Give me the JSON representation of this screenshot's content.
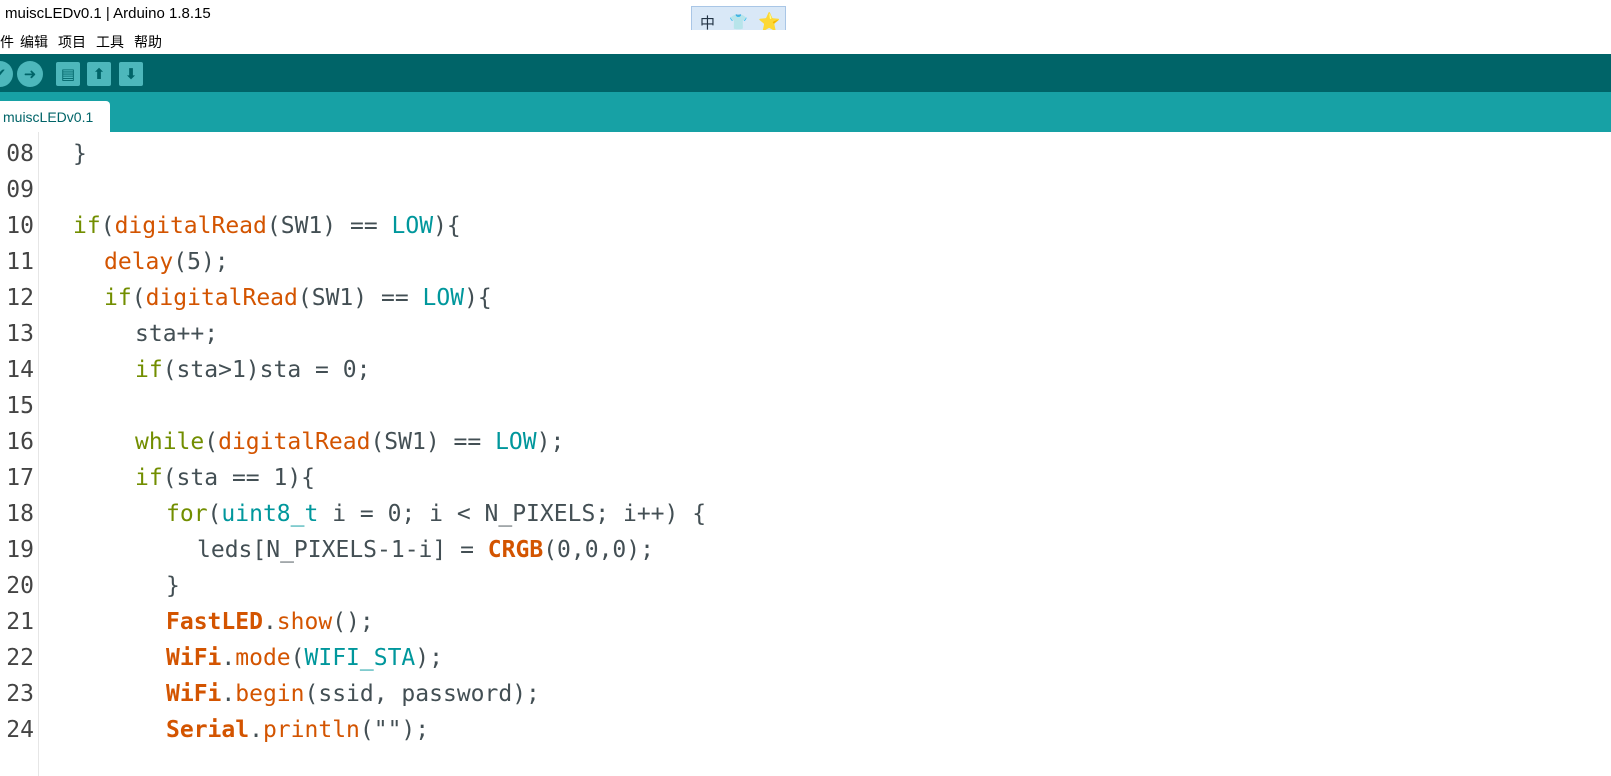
{
  "window": {
    "title": "muiscLEDv0.1 | Arduino 1.8.15"
  },
  "ime": {
    "items": [
      "中",
      "👕",
      "⭐"
    ]
  },
  "menu": {
    "items": [
      "件",
      "编辑",
      "项目",
      "工具",
      "帮助"
    ]
  },
  "toolbar": {
    "verify_icon": "✔",
    "upload_icon": "➜",
    "new_icon": "▤",
    "open_icon": "⬆",
    "save_icon": "⬇"
  },
  "tab": {
    "label": "muiscLEDv0.1"
  },
  "theme": {
    "toolbar_bg": "#006468",
    "tabbar_bg": "#17a1a5",
    "keyword": "#728e00",
    "function": "#d35400",
    "constant": "#00979c"
  },
  "editor": {
    "lines": [
      {
        "num": "08",
        "indent": 1,
        "tokens": [
          {
            "t": "}",
            "c": "t"
          }
        ]
      },
      {
        "num": "09",
        "indent": 0,
        "tokens": []
      },
      {
        "num": "10",
        "indent": 1,
        "tokens": [
          {
            "t": "if",
            "c": "kw"
          },
          {
            "t": "(",
            "c": "t"
          },
          {
            "t": "digitalRead",
            "c": "fn"
          },
          {
            "t": "(SW1) == ",
            "c": "t"
          },
          {
            "t": "LOW",
            "c": "const"
          },
          {
            "t": "){",
            "c": "t"
          }
        ]
      },
      {
        "num": "11",
        "indent": 2,
        "tokens": [
          {
            "t": "delay",
            "c": "fn"
          },
          {
            "t": "(5);",
            "c": "t"
          }
        ]
      },
      {
        "num": "12",
        "indent": 2,
        "tokens": [
          {
            "t": "if",
            "c": "kw"
          },
          {
            "t": "(",
            "c": "t"
          },
          {
            "t": "digitalRead",
            "c": "fn"
          },
          {
            "t": "(SW1) == ",
            "c": "t"
          },
          {
            "t": "LOW",
            "c": "const"
          },
          {
            "t": "){",
            "c": "t"
          }
        ]
      },
      {
        "num": "13",
        "indent": 3,
        "tokens": [
          {
            "t": "sta++;",
            "c": "t"
          }
        ]
      },
      {
        "num": "14",
        "indent": 3,
        "tokens": [
          {
            "t": "if",
            "c": "kw"
          },
          {
            "t": "(sta>1)sta = 0;",
            "c": "t"
          }
        ]
      },
      {
        "num": "15",
        "indent": 0,
        "tokens": []
      },
      {
        "num": "16",
        "indent": 3,
        "tokens": [
          {
            "t": "while",
            "c": "kw"
          },
          {
            "t": "(",
            "c": "t"
          },
          {
            "t": "digitalRead",
            "c": "fn"
          },
          {
            "t": "(SW1) == ",
            "c": "t"
          },
          {
            "t": "LOW",
            "c": "const"
          },
          {
            "t": ");",
            "c": "t"
          }
        ]
      },
      {
        "num": "17",
        "indent": 3,
        "tokens": [
          {
            "t": "if",
            "c": "kw"
          },
          {
            "t": "(sta == 1){",
            "c": "t"
          }
        ]
      },
      {
        "num": "18",
        "indent": 4,
        "tokens": [
          {
            "t": "for",
            "c": "kw"
          },
          {
            "t": "(",
            "c": "t"
          },
          {
            "t": "uint8_t",
            "c": "const"
          },
          {
            "t": " i = 0; i < N_PIXELS; i++) {",
            "c": "t"
          }
        ]
      },
      {
        "num": "19",
        "indent": 5,
        "tokens": [
          {
            "t": "leds[N_PIXELS-1-i] = ",
            "c": "t"
          },
          {
            "t": "CRGB",
            "c": "cls"
          },
          {
            "t": "(0,0,0);",
            "c": "t"
          }
        ]
      },
      {
        "num": "20",
        "indent": 4,
        "tokens": [
          {
            "t": "}",
            "c": "t"
          }
        ]
      },
      {
        "num": "21",
        "indent": 4,
        "tokens": [
          {
            "t": "FastLED",
            "c": "cls"
          },
          {
            "t": ".",
            "c": "t"
          },
          {
            "t": "show",
            "c": "fn"
          },
          {
            "t": "();",
            "c": "t"
          }
        ]
      },
      {
        "num": "22",
        "indent": 4,
        "tokens": [
          {
            "t": "WiFi",
            "c": "cls"
          },
          {
            "t": ".",
            "c": "t"
          },
          {
            "t": "mode",
            "c": "fn"
          },
          {
            "t": "(",
            "c": "t"
          },
          {
            "t": "WIFI_STA",
            "c": "const"
          },
          {
            "t": ");",
            "c": "t"
          }
        ]
      },
      {
        "num": "23",
        "indent": 4,
        "tokens": [
          {
            "t": "WiFi",
            "c": "cls"
          },
          {
            "t": ".",
            "c": "t"
          },
          {
            "t": "begin",
            "c": "fn"
          },
          {
            "t": "(ssid, password);",
            "c": "t"
          }
        ]
      },
      {
        "num": "24",
        "indent": 4,
        "tokens": [
          {
            "t": "Serial",
            "c": "cls"
          },
          {
            "t": ".",
            "c": "t"
          },
          {
            "t": "println",
            "c": "fn"
          },
          {
            "t": "(\"\");",
            "c": "t"
          }
        ]
      }
    ]
  }
}
